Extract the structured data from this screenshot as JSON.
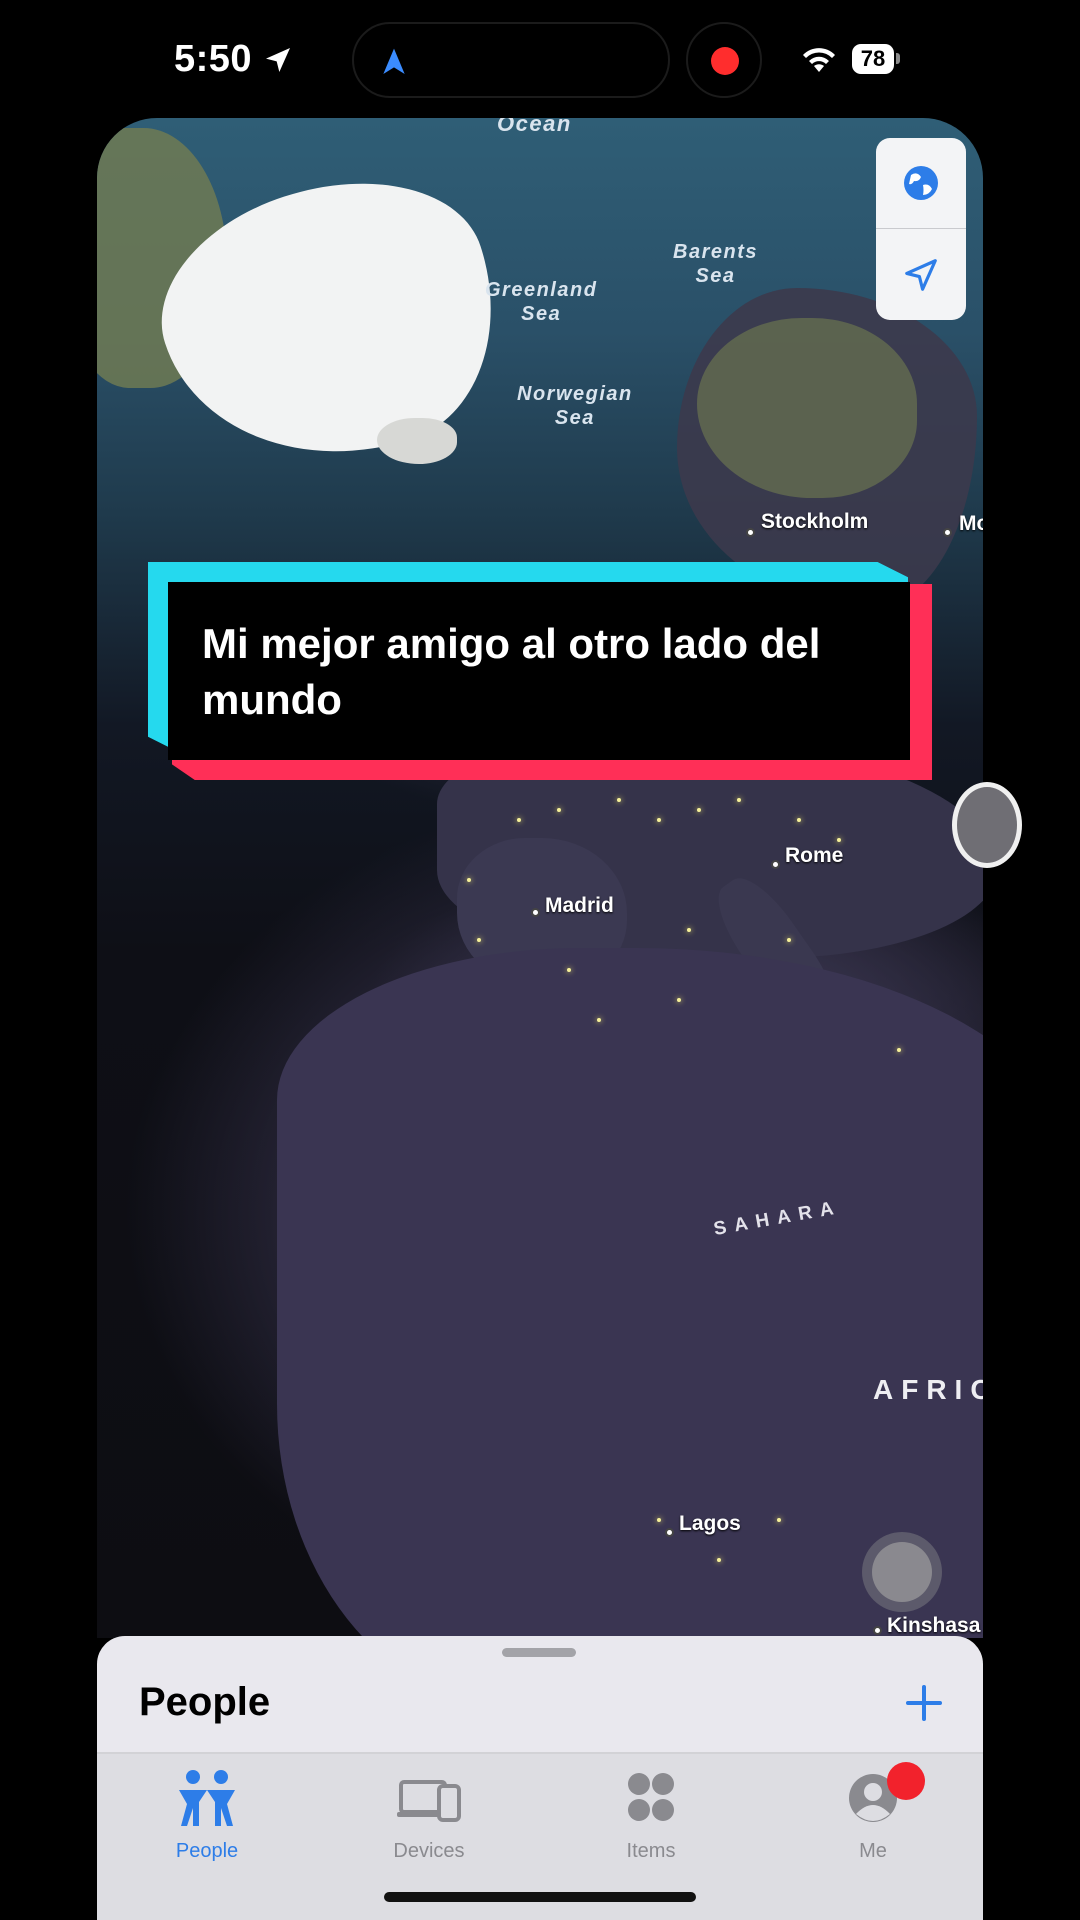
{
  "status_bar": {
    "time": "5:50",
    "battery": "78",
    "colors": {
      "recording_dot": "#ff2d2d",
      "island_arrow": "#3b8cff"
    }
  },
  "map": {
    "labels": {
      "ocean": "Ocean",
      "greenland_sea": "Greenland\nSea",
      "barents_sea": "Barents\nSea",
      "norwegian_sea": "Norwegian\nSea",
      "sahara": "SAHARA",
      "africa": "AFRIC"
    },
    "cities": {
      "stockholm": "Stockholm",
      "moscow_partial": "Mo",
      "rome": "Rome",
      "madrid": "Madrid",
      "lagos": "Lagos",
      "kinshasa": "Kinshasa"
    },
    "controls": {
      "globe": "globe-icon",
      "locate": "location-arrow-icon"
    }
  },
  "caption": {
    "text": "Mi mejor amigo al otro lado del mundo",
    "colors": {
      "cyan": "#25d9ee",
      "red": "#ff2f57"
    }
  },
  "sheet": {
    "title": "People",
    "add_icon": "plus-icon"
  },
  "tab_bar": {
    "tabs": [
      {
        "label": "People",
        "icon": "people-icon",
        "active": true
      },
      {
        "label": "Devices",
        "icon": "devices-icon",
        "active": false
      },
      {
        "label": "Items",
        "icon": "items-icon",
        "active": false
      },
      {
        "label": "Me",
        "icon": "person-circle-icon",
        "active": false,
        "badge": true
      }
    ],
    "colors": {
      "active": "#2d7de8",
      "inactive": "#8a8a8f",
      "badge": "#f2222c"
    }
  }
}
